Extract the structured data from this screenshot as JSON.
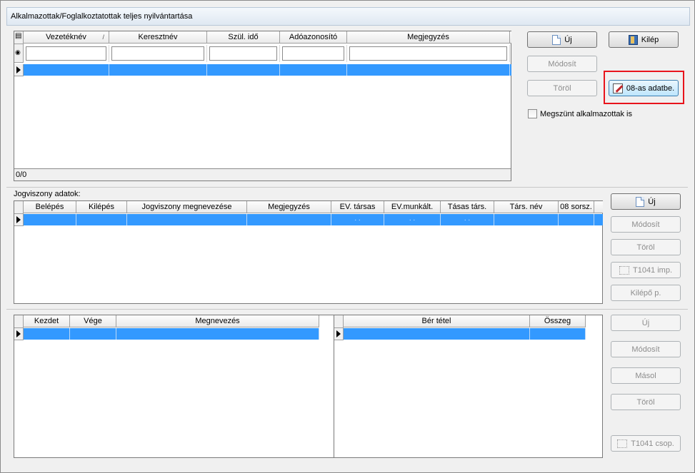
{
  "window": {
    "title": "Alkalmazottak/Foglalkoztatottak teljes nyilvántartása"
  },
  "employees": {
    "columns": [
      "Vezetéknév",
      "Keresztnév",
      "Szül. idő",
      "Adóazonosító",
      "Megjegyzés"
    ],
    "sort_mark": "/",
    "filters": [
      "",
      "",
      "",
      "",
      ""
    ],
    "record_count": "0/0"
  },
  "main_buttons": {
    "new_label": "Új",
    "exit_label": "Kilép",
    "modify_label": "Módosít",
    "delete_label": "Töröl",
    "data_08_label": "08-as adatbe.",
    "terminated_label": "Megszünt alkalmazottak is"
  },
  "employment": {
    "section_label": "Jogviszony adatok:",
    "columns": [
      "Belépés",
      "Kilépés",
      "Jogviszony megnevezése",
      "Megjegyzés",
      "EV. társas",
      "EV.munkált.",
      "Tásas társ.",
      "Társ. név",
      "08 sorsz."
    ],
    "row_values": [
      "",
      "",
      "",
      "",
      ". .",
      ". .",
      ". .",
      "",
      ""
    ],
    "new_label": "Új",
    "modify_label": "Módosít",
    "delete_label": "Töröl",
    "import_label": "T1041 imp.",
    "exit_form_label": "Kilépő p."
  },
  "periods": {
    "columns": [
      "Kezdet",
      "Vége",
      "Megnevezés"
    ]
  },
  "wages": {
    "columns": [
      "Bér tétel",
      "Összeg"
    ],
    "new_label": "Új",
    "modify_label": "Módosít",
    "copy_label": "Másol",
    "delete_label": "Töröl",
    "group_label": "T1041 csop."
  },
  "icons": {
    "new": "document-icon",
    "exit": "door-exit-icon",
    "edit08": "edit-icon",
    "import": "import-icon"
  },
  "colors": {
    "selection": "#3399ff",
    "highlight": "#e8141c"
  }
}
